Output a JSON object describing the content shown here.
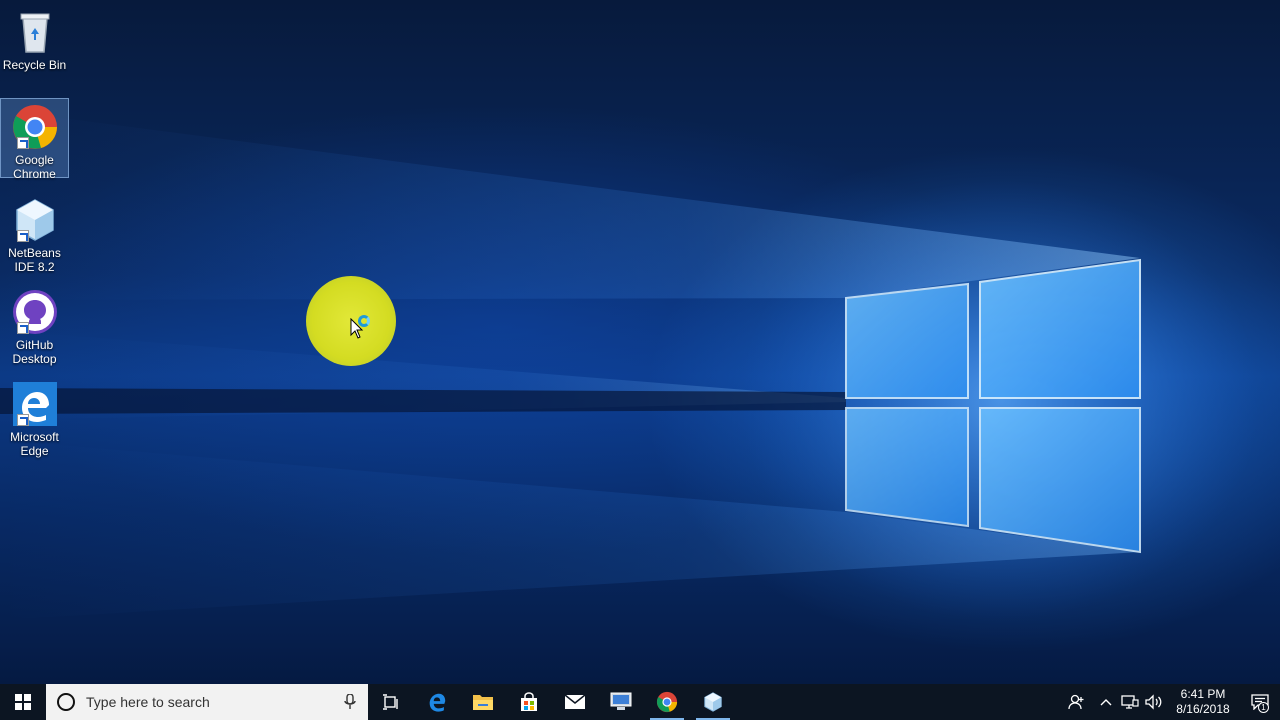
{
  "desktop": {
    "icons": [
      {
        "label": "Recycle Bin",
        "icon": "recycle-bin-icon",
        "selected": false
      },
      {
        "label": "Google Chrome",
        "icon": "chrome-icon",
        "selected": true
      },
      {
        "label": "NetBeans IDE 8.2",
        "icon": "netbeans-icon",
        "selected": false
      },
      {
        "label": "GitHub Desktop",
        "icon": "github-desktop-icon",
        "selected": false
      },
      {
        "label": "Microsoft Edge",
        "icon": "edge-icon",
        "selected": false
      }
    ],
    "cursor": {
      "state": "busy",
      "highlight_color": "#d8df2a"
    }
  },
  "taskbar": {
    "start_icon": "windows-logo-icon",
    "search": {
      "placeholder": "Type here to search"
    },
    "pinned": [
      {
        "icon": "task-view-icon"
      },
      {
        "icon": "edge-icon"
      },
      {
        "icon": "file-explorer-icon"
      },
      {
        "icon": "store-icon"
      },
      {
        "icon": "mail-icon"
      },
      {
        "icon": "remote-desktop-icon"
      },
      {
        "icon": "chrome-icon",
        "running": true
      },
      {
        "icon": "netbeans-icon",
        "running": true
      }
    ],
    "tray": {
      "icons": [
        "people-icon",
        "show-hidden-icons-icon",
        "network-icon",
        "volume-icon"
      ],
      "time": "6:41 PM",
      "date": "8/16/2018",
      "notification_count": "1"
    }
  },
  "colors": {
    "taskbar": "#0c1522",
    "accent": "#0078d7",
    "wallpaper_glow": "#2f8cff"
  }
}
